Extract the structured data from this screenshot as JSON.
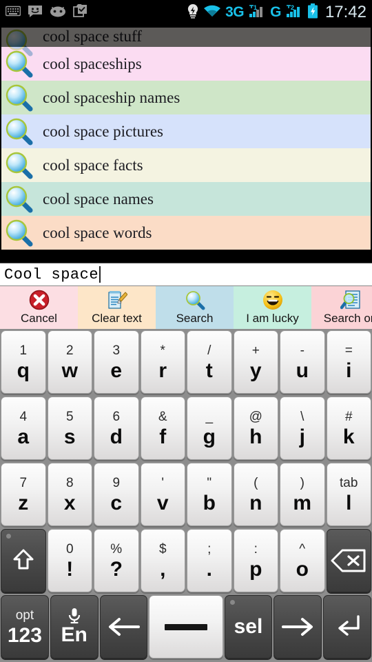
{
  "statusbar": {
    "icons_left": [
      "keyboard-icon",
      "message-smiley-icon",
      "android-face-icon",
      "bag-check-icon"
    ],
    "icons_right": [
      "flash-bulb-icon",
      "wifi-icon",
      "signal-1-icon",
      "signal-2-icon",
      "battery-charging-icon"
    ],
    "network_3g": "3G",
    "network_g": "G",
    "sim1": "1",
    "sim2": "2",
    "clock": "17:42"
  },
  "suggestions": {
    "items": [
      {
        "text": "cool space stuff",
        "bg": "#f2ece8",
        "partial": true
      },
      {
        "text": "cool spaceships",
        "bg": "#fbdcf2",
        "partial": false
      },
      {
        "text": "cool spaceship names",
        "bg": "#cfe6c8",
        "partial": false
      },
      {
        "text": "cool space pictures",
        "bg": "#d6e2fb",
        "partial": false
      },
      {
        "text": "cool space facts",
        "bg": "#f4f3e1",
        "partial": false
      },
      {
        "text": "cool space names",
        "bg": "#c6e5da",
        "partial": false
      },
      {
        "text": "cool space words",
        "bg": "#fbdcc6",
        "partial": false
      }
    ],
    "row_icon": "magnifier-icon"
  },
  "input": {
    "value": "Cool space",
    "placeholder": ""
  },
  "actionbar": {
    "items": [
      {
        "label": "Cancel",
        "icon": "cancel-x-icon",
        "bg": "#fcdee3"
      },
      {
        "label": "Clear text",
        "icon": "clear-text-icon",
        "bg": "#fde6c8"
      },
      {
        "label": "Search",
        "icon": "search-magnifier-icon",
        "bg": "#bfdeea"
      },
      {
        "label": "I am lucky",
        "icon": "smiley-lucky-icon",
        "bg": "#c6efdf"
      },
      {
        "label": "Search on",
        "icon": "search-document-icon",
        "bg": "#fbd3d6"
      }
    ]
  },
  "keyboard": {
    "rows": [
      [
        {
          "sub": "1",
          "main": "q",
          "style": "light",
          "name": "key-q"
        },
        {
          "sub": "2",
          "main": "w",
          "style": "light",
          "name": "key-w"
        },
        {
          "sub": "3",
          "main": "e",
          "style": "light",
          "name": "key-e"
        },
        {
          "sub": "*",
          "main": "r",
          "style": "light",
          "name": "key-r"
        },
        {
          "sub": "/",
          "main": "t",
          "style": "light",
          "name": "key-t"
        },
        {
          "sub": "+",
          "main": "y",
          "style": "light",
          "name": "key-y"
        },
        {
          "sub": "-",
          "main": "u",
          "style": "light",
          "name": "key-u"
        },
        {
          "sub": "=",
          "main": "i",
          "style": "light",
          "name": "key-i"
        }
      ],
      [
        {
          "sub": "4",
          "main": "a",
          "style": "light",
          "name": "key-a"
        },
        {
          "sub": "5",
          "main": "s",
          "style": "light",
          "name": "key-s"
        },
        {
          "sub": "6",
          "main": "d",
          "style": "light",
          "name": "key-d"
        },
        {
          "sub": "&",
          "main": "f",
          "style": "light",
          "name": "key-f"
        },
        {
          "sub": "_",
          "main": "g",
          "style": "light",
          "name": "key-g"
        },
        {
          "sub": "@",
          "main": "h",
          "style": "light",
          "name": "key-h"
        },
        {
          "sub": "\\",
          "main": "j",
          "style": "light",
          "name": "key-j"
        },
        {
          "sub": "#",
          "main": "k",
          "style": "light",
          "name": "key-k"
        }
      ],
      [
        {
          "sub": "7",
          "main": "z",
          "style": "light",
          "name": "key-z"
        },
        {
          "sub": "8",
          "main": "x",
          "style": "light",
          "name": "key-x"
        },
        {
          "sub": "9",
          "main": "c",
          "style": "light",
          "name": "key-c"
        },
        {
          "sub": "'",
          "main": "v",
          "style": "light",
          "name": "key-v"
        },
        {
          "sub": "\"",
          "main": "b",
          "style": "light",
          "name": "key-b"
        },
        {
          "sub": "(",
          "main": "n",
          "style": "light",
          "name": "key-n"
        },
        {
          "sub": ")",
          "main": "m",
          "style": "light",
          "name": "key-m"
        },
        {
          "sub": "tab",
          "main": "l",
          "style": "light",
          "name": "key-l-tab"
        }
      ],
      [
        {
          "sub": "",
          "main": "",
          "style": "dark",
          "icon": "shift-up-arrow-icon",
          "name": "key-shift"
        },
        {
          "sub": "0",
          "main": "!",
          "style": "light",
          "name": "key-exclaim"
        },
        {
          "sub": "%",
          "main": "?",
          "style": "light",
          "name": "key-question"
        },
        {
          "sub": "$",
          "main": ",",
          "style": "light",
          "name": "key-comma"
        },
        {
          "sub": ";",
          "main": ".",
          "style": "light",
          "name": "key-period"
        },
        {
          "sub": ":",
          "main": "p",
          "style": "light",
          "name": "key-p"
        },
        {
          "sub": "^",
          "main": "o",
          "style": "light",
          "name": "key-o"
        },
        {
          "sub": "",
          "main": "",
          "style": "dark",
          "icon": "backspace-icon",
          "name": "key-backspace"
        }
      ],
      [
        {
          "sub": "opt",
          "main": "123",
          "style": "dark",
          "name": "key-opt-123"
        },
        {
          "sub": "",
          "main": "En",
          "style": "dark",
          "icon": "microphone-icon",
          "name": "key-mic-en"
        },
        {
          "sub": "",
          "main": "",
          "style": "dark",
          "icon": "arrow-left-icon",
          "name": "key-arrow-left"
        },
        {
          "sub": "",
          "main": "",
          "style": "light",
          "icon": "spacebar-icon",
          "name": "key-space"
        },
        {
          "sub": "",
          "main": "sel",
          "style": "dark",
          "name": "key-sel"
        },
        {
          "sub": "",
          "main": "",
          "style": "dark",
          "icon": "arrow-right-icon",
          "name": "key-arrow-right"
        },
        {
          "sub": "",
          "main": "",
          "style": "dark",
          "icon": "enter-return-icon",
          "name": "key-enter"
        }
      ]
    ]
  }
}
